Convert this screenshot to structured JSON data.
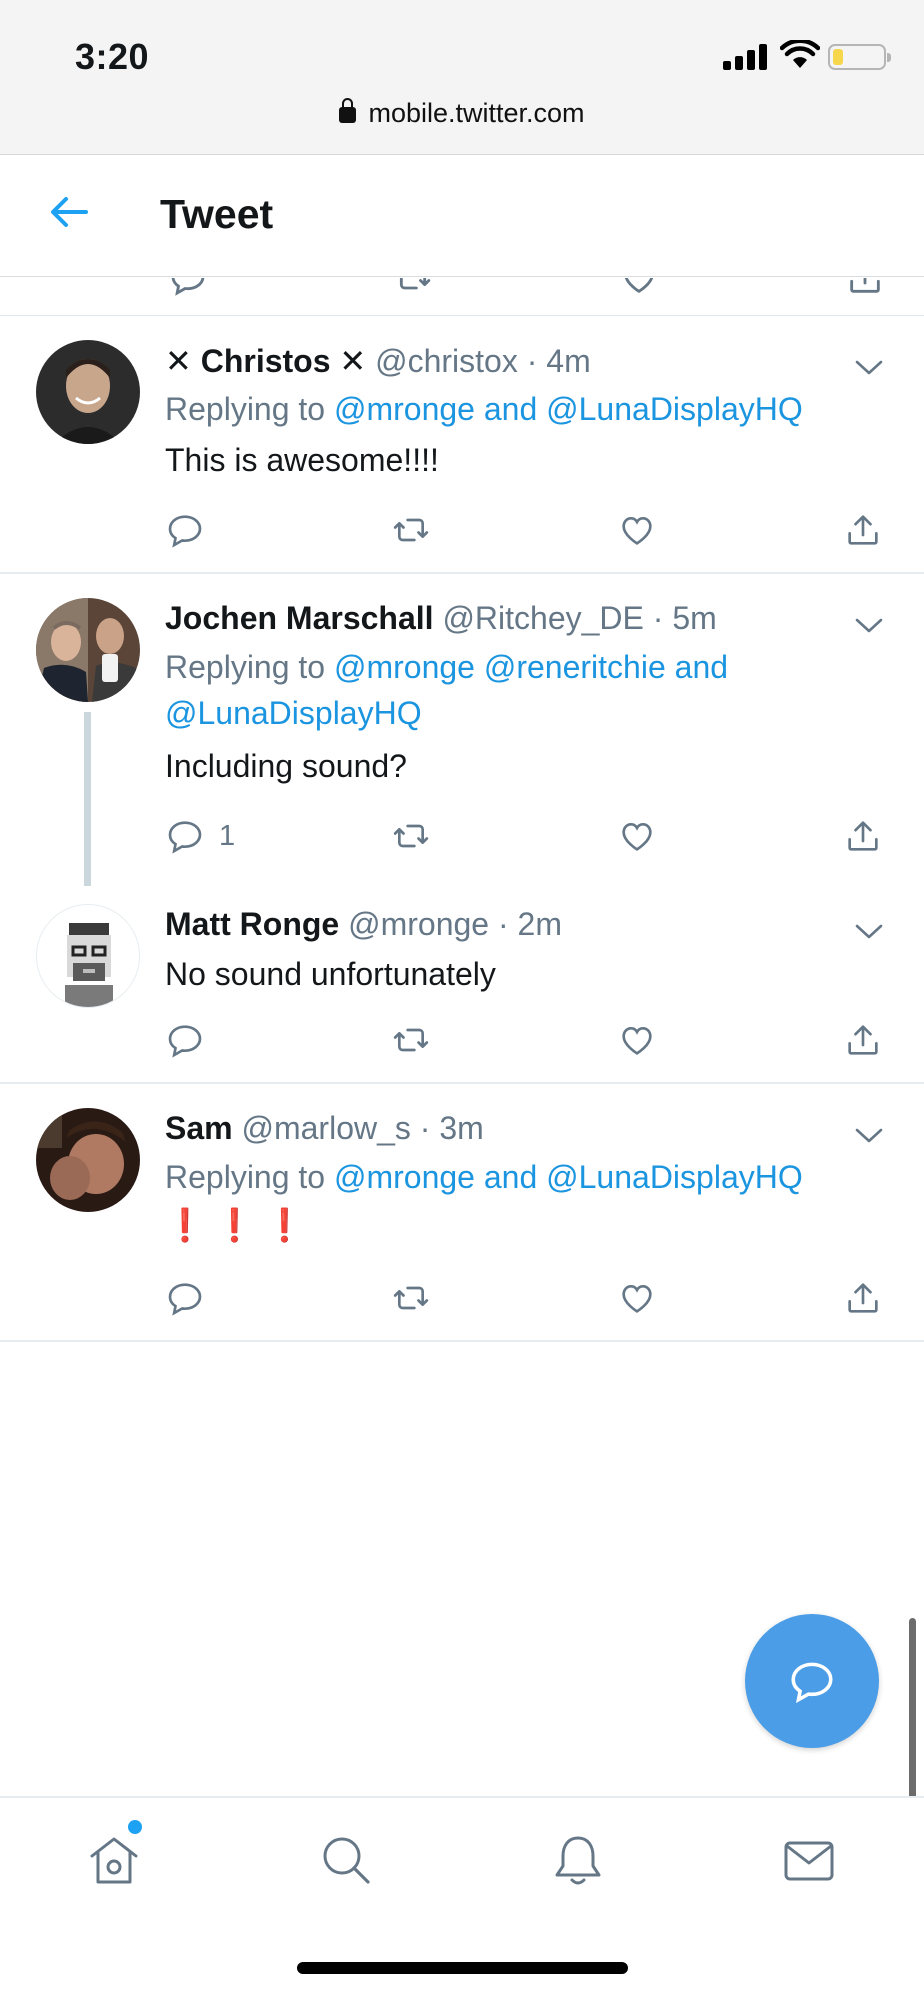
{
  "status_bar": {
    "time": "3:20",
    "icons": [
      "signal-icon",
      "wifi-icon",
      "battery-icon"
    ]
  },
  "browser": {
    "url": "mobile.twitter.com",
    "lock_icon": "lock-icon"
  },
  "header": {
    "title": "Tweet",
    "back_icon": "back-arrow-icon"
  },
  "tweets": [
    {
      "name": "Christos",
      "name_prefix": "✕",
      "name_suffix": "✕",
      "handle": "@christox",
      "time": "4m",
      "replying_prefix": "Replying to",
      "replying_1": "@mronge",
      "replying_and": "and",
      "replying_2": "@LunaDisplayHQ",
      "text": "This is awesome!!!!"
    },
    {
      "name": "Jochen Marschall",
      "handle": "@Ritchey_DE",
      "time": "5m",
      "replying_prefix": "Replying to",
      "replying_1": "@mronge",
      "replying_2": "@reneritchie",
      "replying_and": "and",
      "replying_3": "@LunaDisplayHQ",
      "text": "Including sound?",
      "reply_count": "1"
    },
    {
      "name": "Matt Ronge",
      "handle": "@mronge",
      "time": "2m",
      "text": "No sound unfortunately"
    },
    {
      "name": "Sam",
      "handle": "@marlow_s",
      "time": "3m",
      "replying_prefix": "Replying to",
      "replying_1": "@mronge",
      "replying_and": "and",
      "replying_2": "@LunaDisplayHQ",
      "text": "❗❗❗"
    }
  ],
  "separator": "·",
  "fab": {
    "icon": "compose-reply-icon"
  },
  "bottom_nav": {
    "items": [
      "home-icon",
      "search-icon",
      "notifications-icon",
      "messages-icon"
    ],
    "home_has_new": true
  },
  "colors": {
    "accent": "#1b95e0",
    "fab": "#4a9de6",
    "meta_gray": "#657786",
    "text": "#14171a"
  }
}
